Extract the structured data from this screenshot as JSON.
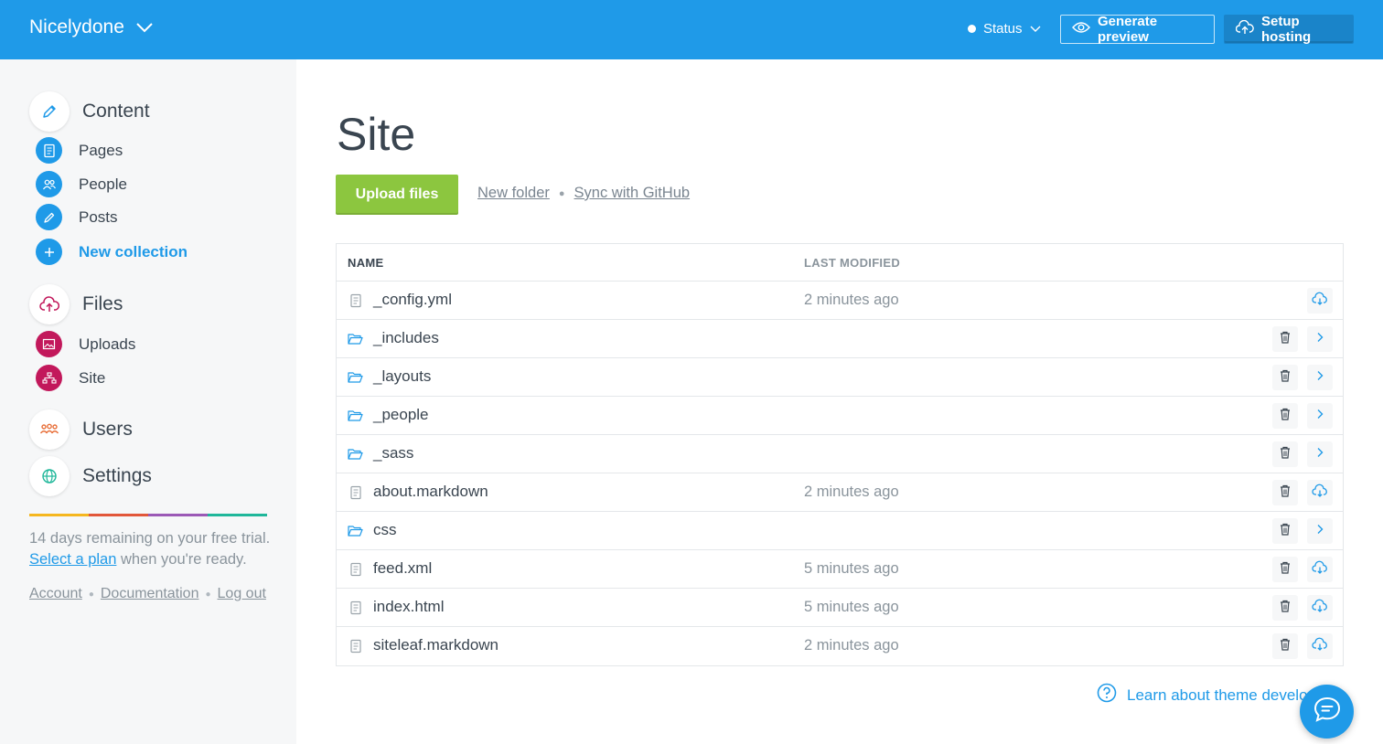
{
  "header": {
    "site_name": "Nicelydone",
    "status_label": "Status",
    "generate_preview_label": "Generate preview",
    "setup_hosting_label": "Setup hosting",
    "brand_color": "#1f9ae8"
  },
  "sidebar": {
    "content_label": "Content",
    "content_items": [
      {
        "label": "Pages",
        "icon": "pages-icon"
      },
      {
        "label": "People",
        "icon": "people-icon"
      },
      {
        "label": "Posts",
        "icon": "pencil-icon"
      }
    ],
    "new_collection_label": "New collection",
    "files_label": "Files",
    "files_items": [
      {
        "label": "Uploads",
        "icon": "image-icon"
      },
      {
        "label": "Site",
        "icon": "sitemap-icon"
      }
    ],
    "users_label": "Users",
    "settings_label": "Settings",
    "color_bar": [
      "#f5b71f",
      "#e2573a",
      "#9b59b6",
      "#1fb79a"
    ],
    "trial_text": "14 days remaining on your free trial.",
    "select_plan_label": "Select a plan",
    "trial_suffix": "when you're ready.",
    "footer_links": {
      "account": "Account",
      "documentation": "Documentation",
      "logout": "Log out"
    }
  },
  "main": {
    "title": "Site",
    "upload_label": "Upload files",
    "new_folder_label": "New folder",
    "sync_label": "Sync with GitHub",
    "columns": {
      "name": "NAME",
      "modified": "LAST MODIFIED"
    },
    "files": [
      {
        "name": "_config.yml",
        "type": "file",
        "modified": "2 minutes ago"
      },
      {
        "name": "_includes",
        "type": "folder",
        "modified": ""
      },
      {
        "name": "_layouts",
        "type": "folder",
        "modified": ""
      },
      {
        "name": "_people",
        "type": "folder",
        "modified": ""
      },
      {
        "name": "_sass",
        "type": "folder",
        "modified": ""
      },
      {
        "name": "about.markdown",
        "type": "file",
        "modified": "2 minutes ago"
      },
      {
        "name": "css",
        "type": "folder",
        "modified": ""
      },
      {
        "name": "feed.xml",
        "type": "file",
        "modified": "5 minutes ago"
      },
      {
        "name": "index.html",
        "type": "file",
        "modified": "5 minutes ago"
      },
      {
        "name": "siteleaf.markdown",
        "type": "file",
        "modified": "2 minutes ago"
      }
    ],
    "help_link": "Learn about theme develop"
  }
}
